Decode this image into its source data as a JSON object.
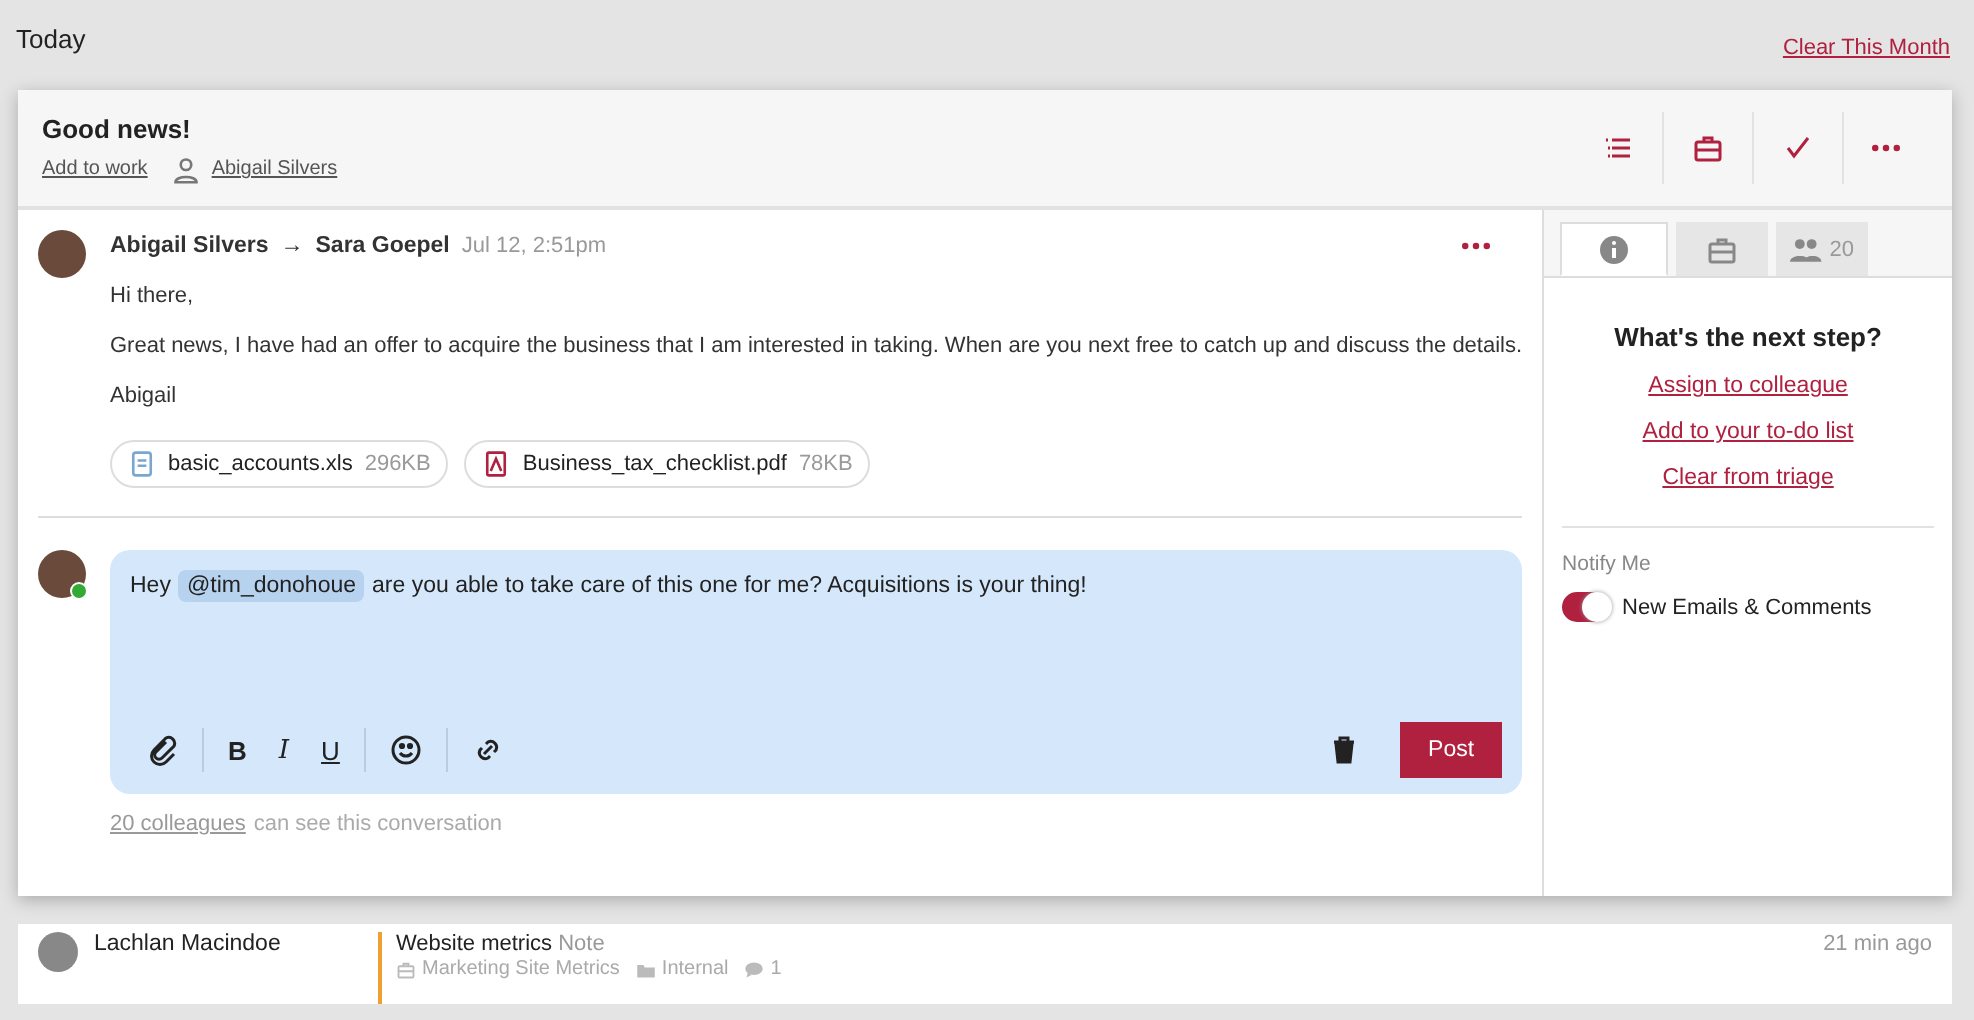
{
  "top": {
    "heading": "Today",
    "clear_link": "Clear This Month"
  },
  "conversation": {
    "title": "Good news!",
    "add_to_work": "Add to work",
    "owner": "Abigail Silvers",
    "actions": [
      {
        "kind": "list"
      },
      {
        "kind": "briefcase"
      },
      {
        "kind": "check"
      },
      {
        "kind": "more"
      }
    ]
  },
  "message": {
    "from": "Abigail Silvers",
    "arrow": "→",
    "to": "Sara Goepel",
    "time": "Jul 12, 2:51pm",
    "paragraphs": [
      "Hi there,",
      "Great news, I have had an offer to acquire the business that I am interested in taking. When are you next free to catch up and discuss the details.",
      "Abigail"
    ],
    "attachments": [
      {
        "kind": "sheet",
        "name": "basic_accounts.xls",
        "size": "296KB"
      },
      {
        "kind": "pdf",
        "name": "Business_tax_checklist.pdf",
        "size": "78KB"
      }
    ]
  },
  "reply": {
    "online": true,
    "before": "Hey",
    "mention": "@tim_donohoue",
    "after": "are you able to take care of this one for me? Acquisitions is your thing!",
    "toolbar": [
      {
        "kind": "attach"
      },
      {
        "kind": "bold",
        "label": "B"
      },
      {
        "kind": "italic",
        "label": "I"
      },
      {
        "kind": "underline",
        "label": "U"
      },
      {
        "kind": "emoji"
      },
      {
        "kind": "link"
      }
    ],
    "post": "Post",
    "visibility_link": "20 colleagues",
    "visibility_text": "can see this conversation"
  },
  "sidebar": {
    "tabs": [
      {
        "kind": "info",
        "selected": true
      },
      {
        "kind": "briefcase",
        "selected": false
      },
      {
        "kind": "people",
        "label": "20",
        "selected": false
      }
    ],
    "heading": "What's the next step?",
    "links": [
      "Assign to colleague",
      "Add to your to-do list",
      "Clear from triage"
    ],
    "notify_label": "Notify Me",
    "toggle": {
      "label": "New Emails & Comments",
      "on": true
    }
  },
  "feed": [
    {
      "name": "Lachlan Macindoe",
      "color": "#f0a030",
      "title": "Website metrics",
      "type": "Note",
      "time": "21 min ago",
      "tags": [
        {
          "kind": "briefcase",
          "label": "Marketing Site Metrics"
        },
        {
          "kind": "folder",
          "label": "Internal"
        },
        {
          "kind": "comment",
          "label": "1"
        }
      ]
    }
  ]
}
